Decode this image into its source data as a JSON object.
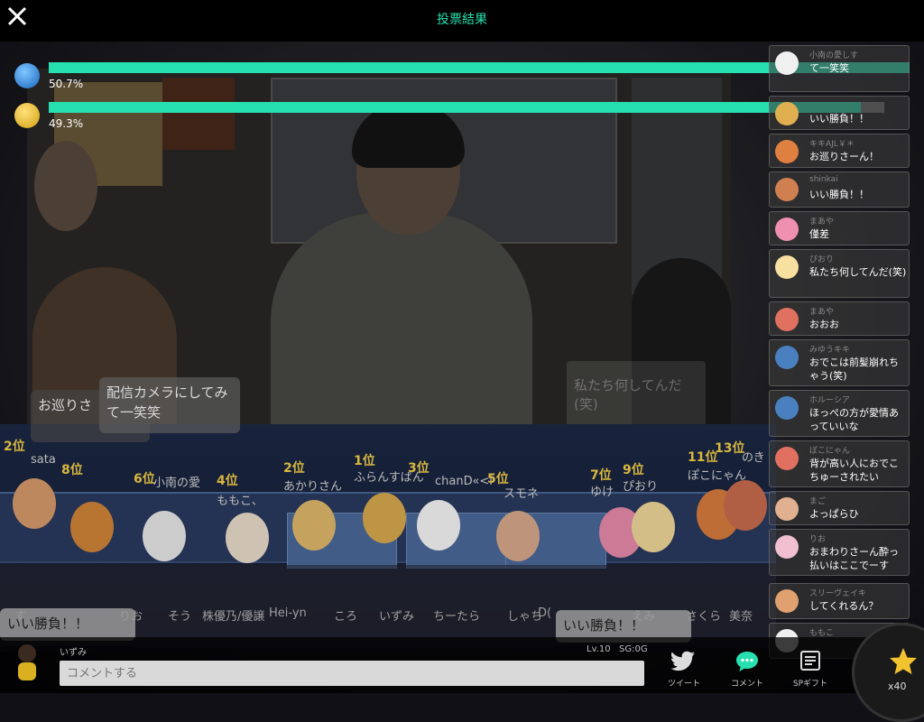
{
  "header": {
    "title": "投票結果"
  },
  "poll": {
    "options": [
      {
        "label": "50.7%",
        "value": 0.507,
        "color": "#27e0b0",
        "icon": "blue-ball-icon"
      },
      {
        "label": "49.3%",
        "value": 0.493,
        "color": "#27e0b0",
        "icon": "compass-icon"
      }
    ]
  },
  "stage": {
    "bubble_left": "お巡りさ",
    "bubble_right": "配信カメラにしてみて一笑笑",
    "ghost_comment": "私たち何してんだ(笑)",
    "bottom_bubble_left": "いい勝負！！",
    "bottom_bubble_right": "いい勝負！！",
    "ranks": [
      {
        "rank": "2位",
        "name": "sata"
      },
      {
        "rank": "8位",
        "name": ""
      },
      {
        "rank": "6位",
        "name": "小南の愛"
      },
      {
        "rank": "4位",
        "name": "ももこ、"
      },
      {
        "rank": "2位",
        "name": "あかりさん"
      },
      {
        "rank": "1位",
        "name": "ふらんすぱん"
      },
      {
        "rank": "3位",
        "name": "chanD«<l"
      },
      {
        "rank": "5位",
        "name": "スモネ"
      },
      {
        "rank": "7位",
        "name": "ゆけ"
      },
      {
        "rank": "9位",
        "name": "ぴおり"
      },
      {
        "rank": "11位",
        "name": "ぽこにゃん"
      },
      {
        "rank": "13位",
        "name": "のき"
      }
    ],
    "row2_names": [
      "す",
      "りお",
      "そう",
      "株優乃/優譲",
      "Hei-yn",
      "ころ",
      "いずみ",
      "ちーたら",
      "しゃち",
      "D(",
      "えみ",
      "さくら",
      "美奈"
    ]
  },
  "comments": [
    {
      "user": "小南の愛しす",
      "text": "て一笑笑"
    },
    {
      "user": "",
      "text": "いい勝負！！"
    },
    {
      "user": "キキAJL￥＊",
      "text": "お巡りさーん！"
    },
    {
      "user": "shinkai",
      "text": "いい勝負！！"
    },
    {
      "user": "まあや",
      "text": "僅差"
    },
    {
      "user": "ぴおり",
      "text": "私たち何してんだ(笑)"
    },
    {
      "user": "まあや",
      "text": "おおお"
    },
    {
      "user": "みゆうキキ",
      "text": "おでこは前髪崩れちゃう(笑)"
    },
    {
      "user": "ホルーシア",
      "text": "ほっぺの方が愛情あっていいな"
    },
    {
      "user": "ぽこにゃん",
      "text": "背が高い人におでこちゅーされたい"
    },
    {
      "user": "まご",
      "text": "よっぱらひ"
    },
    {
      "user": "りお",
      "text": "おまわりさーん酔っ払いはここでーす"
    },
    {
      "user": "スリーヴェイキ",
      "text": "してくれるん？"
    },
    {
      "user": "ももこ",
      "text": ""
    }
  ],
  "bottom": {
    "self_name": "いずみ",
    "level": "Lv.10",
    "sg": "SG:0G",
    "input_placeholder": "コメントする",
    "tweet_label": "ツイート",
    "comment_label": "コメント",
    "gift_label": "SPギフト",
    "star_count": "x40"
  },
  "colors": {
    "accent": "#27e0b0",
    "rank": "#ffd84a"
  }
}
